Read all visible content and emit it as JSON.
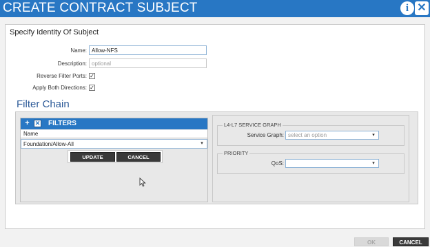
{
  "window": {
    "title": "CREATE CONTRACT SUBJECT",
    "info_glyph": "i",
    "close_glyph": "✕",
    "accent_color": "#2877c4"
  },
  "identity": {
    "section_title": "Specify Identity Of Subject",
    "name_label": "Name:",
    "name_value": "Allow-NFS",
    "description_label": "Description:",
    "description_placeholder": "optional",
    "reverse_label": "Reverse Filter Ports:",
    "reverse_checked": true,
    "apply_label": "Apply Both Directions:",
    "apply_checked": true,
    "check_glyph": "✓"
  },
  "filter_chain": {
    "title": "Filter Chain",
    "filters": {
      "add_glyph": "+",
      "remove_glyph": "✕",
      "header": "FILTERS",
      "column_name": "Name",
      "selected_value": "Foundation/Allow-All",
      "chevron_glyph": "▾",
      "update_label": "UPDATE",
      "cancel_label": "CANCEL"
    },
    "service_graph": {
      "legend": "L4-L7 SERVICE GRAPH",
      "label": "Service Graph:",
      "placeholder": "select an option"
    },
    "priority": {
      "legend": "PRIORITY",
      "label": "QoS:",
      "value": ""
    }
  },
  "footer": {
    "ok_label": "OK",
    "cancel_label": "CANCEL"
  }
}
